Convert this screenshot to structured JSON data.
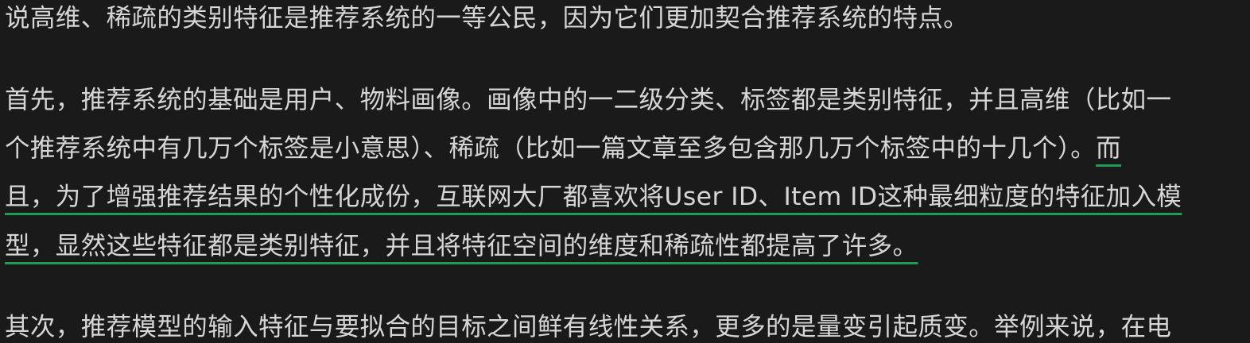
{
  "article": {
    "para1": {
      "line1": "说高维、稀疏的类别特征是推荐系统的一等公民，因为它们更加契合推荐系统的特点。"
    },
    "para2": {
      "line1": "首先，推荐系统的基础是用户、物料画像。画像中的一二级分类、标签都是类别特征，并且高维（比如一",
      "line2_plain": "个推荐系统中有几万个标签是小意思）、稀疏（比如一篇文章至多包含那几万个标签中的十几个）。",
      "line2_highlight": "而",
      "line3_highlight": "且，为了增强推荐结果的个性化成份，互联网大厂都喜欢将User ID、Item ID这种最细粒度的特征加入模",
      "line4_highlight": "型，显然这些特征都是类别特征，并且将特征空间的维度和稀疏性都提高了许多。"
    },
    "para3": {
      "line1": "其次，推荐模型的输入特征与要拟合的目标之间鲜有线性关系，更多的是量变引起质变。举例来说，在电"
    }
  },
  "colors": {
    "background": "#1a1a1a",
    "text": "#d6d6d6",
    "highlight_underline": "#1f9d55"
  }
}
